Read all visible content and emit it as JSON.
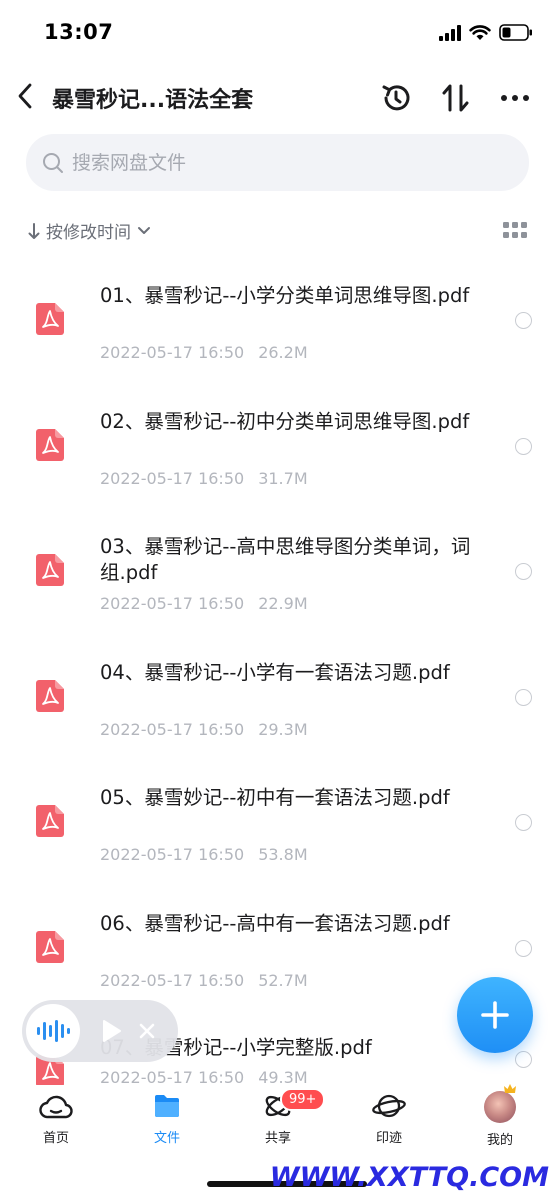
{
  "status_bar": {
    "time": "13:07"
  },
  "nav": {
    "title": "暴雪秒记...语法全套"
  },
  "search": {
    "placeholder": "搜索网盘文件"
  },
  "sort": {
    "label": "按修改时间"
  },
  "files": [
    {
      "name": "01、暴雪秒记--小学分类单词思维导图.pdf",
      "date": "2022-05-17 16:50",
      "size": "26.2M"
    },
    {
      "name": "02、暴雪秒记--初中分类单词思维导图.pdf",
      "date": "2022-05-17 16:50",
      "size": "31.7M"
    },
    {
      "name": "03、暴雪秒记--高中思维导图分类单词，词组.pdf",
      "date": "2022-05-17 16:50",
      "size": "22.9M"
    },
    {
      "name": "04、暴雪秒记--小学有一套语法习题.pdf",
      "date": "2022-05-17 16:50",
      "size": "29.3M"
    },
    {
      "name": "05、暴雪妙记--初中有一套语法习题.pdf",
      "date": "2022-05-17 16:50",
      "size": "53.8M"
    },
    {
      "name": "06、暴雪秒记--高中有一套语法习题.pdf",
      "date": "2022-05-17 16:50",
      "size": "52.7M"
    },
    {
      "name": "07、暴雪秒记--小学完整版.pdf",
      "date": "2022-05-17 16:50",
      "size": "49.3M"
    }
  ],
  "tabs": [
    {
      "label": "首页"
    },
    {
      "label": "文件"
    },
    {
      "label": "共享",
      "badge": "99+"
    },
    {
      "label": "印迹"
    },
    {
      "label": "我的"
    }
  ],
  "watermark": "WWW.XXTTQ.COM",
  "colors": {
    "accent": "#1b8bf5",
    "pdf_icon": "#f2616b",
    "badge": "#ff4d4f"
  }
}
